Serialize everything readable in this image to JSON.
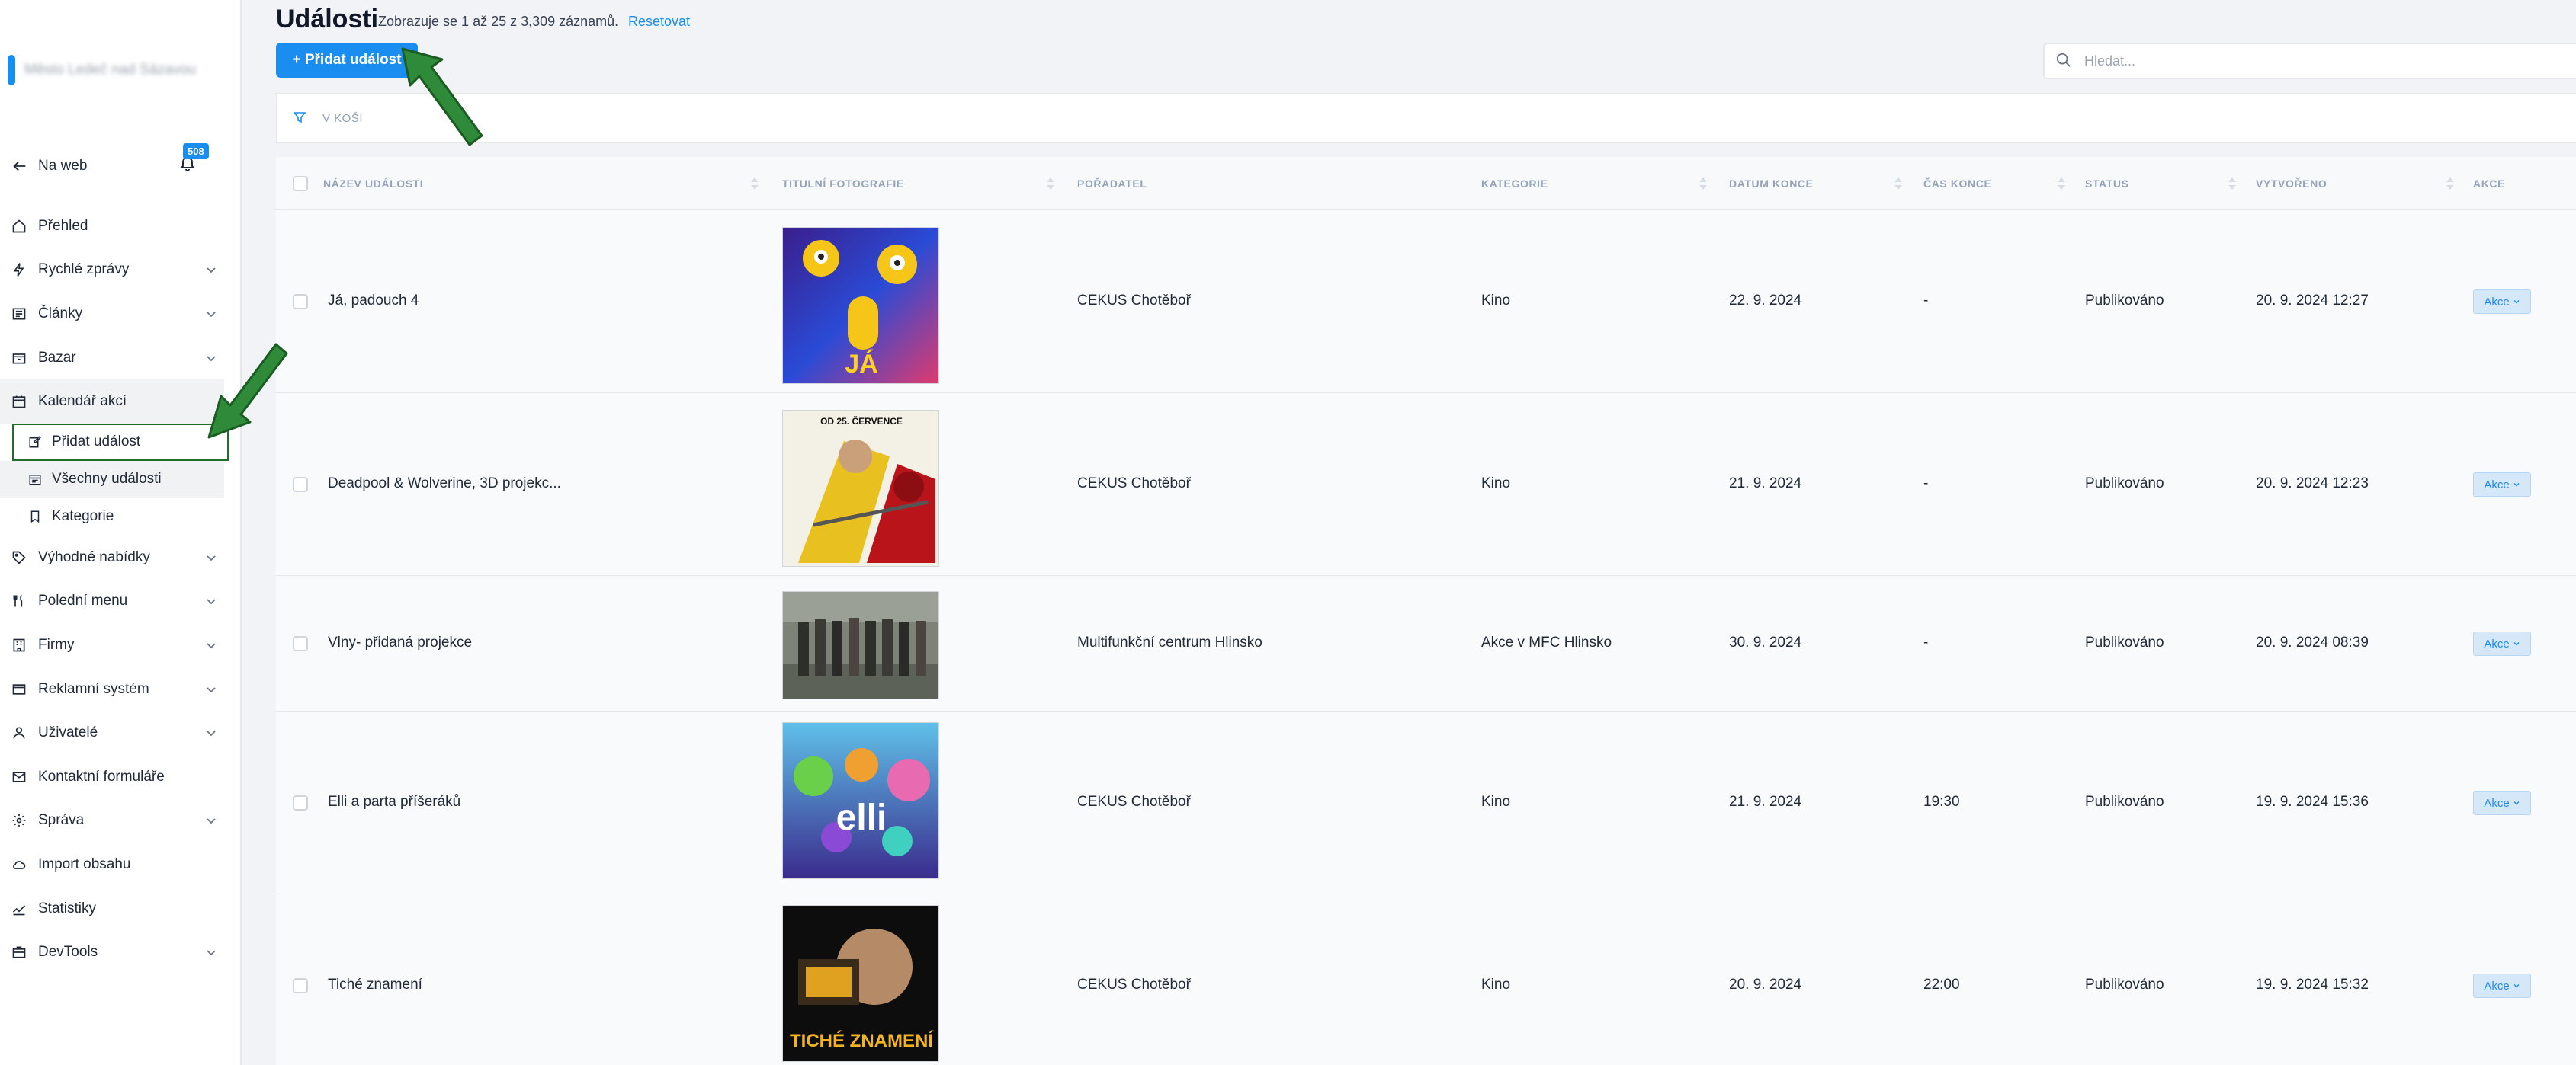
{
  "sidebar": {
    "brand_name": "Město Ledeč nad Sázavou",
    "back_label": "Na web",
    "notifications_count": "508",
    "items": [
      {
        "label": "Přehled",
        "icon": "home-icon",
        "has_chevron": false
      },
      {
        "label": "Rychlé zprávy",
        "icon": "bolt-icon",
        "has_chevron": true
      },
      {
        "label": "Články",
        "icon": "newspaper-icon",
        "has_chevron": true
      },
      {
        "label": "Bazar",
        "icon": "box-icon",
        "has_chevron": true
      },
      {
        "label": "Kalendář akcí",
        "icon": "calendar-icon",
        "has_chevron": false
      }
    ],
    "subitems": [
      {
        "label": "Přidat událost",
        "icon": "edit-icon"
      },
      {
        "label": "Všechny události",
        "icon": "calendar-list-icon"
      },
      {
        "label": "Kategorie",
        "icon": "bookmark-icon"
      }
    ],
    "items_after": [
      {
        "label": "Výhodné nabídky",
        "icon": "tag-icon",
        "has_chevron": true
      },
      {
        "label": "Polední menu",
        "icon": "cutlery-icon",
        "has_chevron": true
      },
      {
        "label": "Firmy",
        "icon": "building-icon",
        "has_chevron": true
      },
      {
        "label": "Reklamní systém",
        "icon": "ad-icon",
        "has_chevron": true
      },
      {
        "label": "Uživatelé",
        "icon": "user-icon",
        "has_chevron": true
      },
      {
        "label": "Kontaktní formuláře",
        "icon": "mail-icon",
        "has_chevron": false
      },
      {
        "label": "Správa",
        "icon": "gear-icon",
        "has_chevron": true
      },
      {
        "label": "Import obsahu",
        "icon": "cloud-icon",
        "has_chevron": false
      },
      {
        "label": "Statistiky",
        "icon": "chart-icon",
        "has_chevron": false
      },
      {
        "label": "DevTools",
        "icon": "toolbox-icon",
        "has_chevron": true
      }
    ]
  },
  "header": {
    "title": "Události",
    "count_text": "Zobrazuje se 1 až 25 z 3,309 záznamů.",
    "reset_label": "Resetovat",
    "add_button": "+ Přidat událost",
    "search_placeholder": "Hledat..."
  },
  "filter": {
    "label": "V KOŠI"
  },
  "table": {
    "columns": [
      "NÁZEV UDÁLOSTI",
      "TITULNÍ FOTOGRAFIE",
      "POŘADATEL",
      "KATEGORIE",
      "DATUM KONCE",
      "ČAS KONCE",
      "STATUS",
      "VYTVOŘENO",
      "AKCE"
    ],
    "rows": [
      {
        "name": "Já, padouch 4",
        "organizer": "CEKUS Chotěboř",
        "category": "Kino",
        "end_date": "22. 9. 2024",
        "end_time": "-",
        "status": "Publikováno",
        "created": "20. 9. 2024 12:27",
        "action": "Akce",
        "poster_text": "JÁ"
      },
      {
        "name": "Deadpool & Wolverine, 3D projekc...",
        "organizer": "CEKUS Chotěboř",
        "category": "Kino",
        "end_date": "21. 9. 2024",
        "end_time": "-",
        "status": "Publikováno",
        "created": "20. 9. 2024 12:23",
        "action": "Akce",
        "poster_text": "OD 25. ČERVENCE"
      },
      {
        "name": "Vlny- přidaná projekce",
        "organizer": "Multifunkční centrum Hlinsko",
        "category": "Akce v MFC Hlinsko",
        "end_date": "30. 9. 2024",
        "end_time": "-",
        "status": "Publikováno",
        "created": "20. 9. 2024 08:39",
        "action": "Akce",
        "poster_text": ""
      },
      {
        "name": "Elli a parta příšeráků",
        "organizer": "CEKUS Chotěboř",
        "category": "Kino",
        "end_date": "21. 9. 2024",
        "end_time": "19:30",
        "status": "Publikováno",
        "created": "19. 9. 2024 15:36",
        "action": "Akce",
        "poster_text": "elli"
      },
      {
        "name": "Tiché znamení",
        "organizer": "CEKUS Chotěboř",
        "category": "Kino",
        "end_date": "20. 9. 2024",
        "end_time": "22:00",
        "status": "Publikováno",
        "created": "19. 9. 2024 15:32",
        "action": "Akce",
        "poster_text": "TICHÉ ZNAMENÍ"
      }
    ]
  },
  "colors": {
    "accent": "#1a8df0",
    "arrow": "#2f8a3a"
  }
}
